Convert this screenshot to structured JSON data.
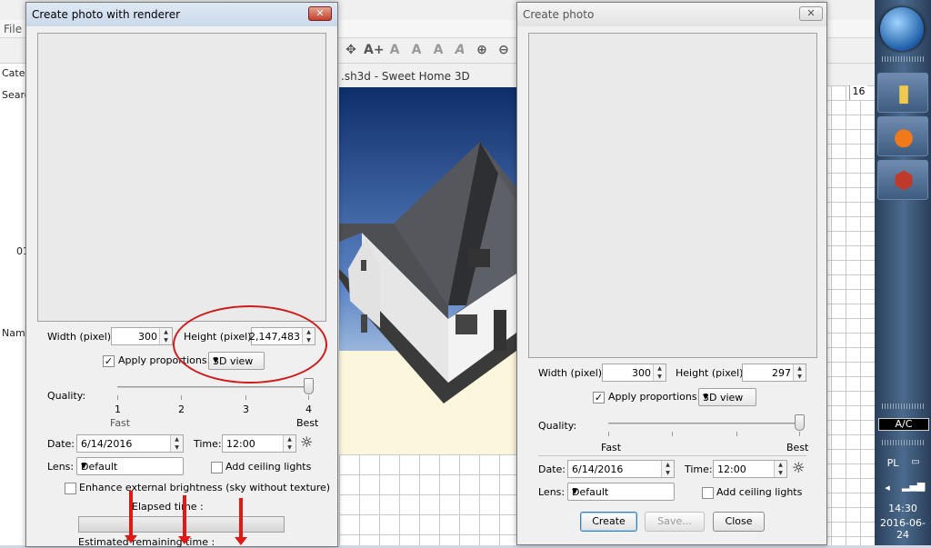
{
  "background": {
    "menu_file": "File",
    "left_labels": [
      "Cate",
      "Searc",
      "01",
      "Nam"
    ],
    "view_title": ".sh3d - Sweet Home 3D",
    "ruler_number": "16"
  },
  "dialog_renderer": {
    "title": "Create photo with renderer",
    "width_label": "Width (pixel):",
    "width_value": "300",
    "height_label": "Height (pixel):",
    "height_value": "2,147,483",
    "apply_proportions_label": "Apply proportions:",
    "apply_proportions_checked": true,
    "proportion_value": "3D view",
    "quality_label": "Quality:",
    "quality_ticks": [
      "1",
      "2",
      "3",
      "4"
    ],
    "quality_level": 4,
    "fast_label": "Fast",
    "best_label": "Best",
    "date_label": "Date:",
    "date_value": "6/14/2016",
    "time_label": "Time:",
    "time_value": "12:00",
    "lens_label": "Lens:",
    "lens_value": "Default",
    "ceiling_lights_label": "Add ceiling lights",
    "brightness_label": "Enhance external brightness (sky without texture)",
    "elapsed_label": "Elapsed time :",
    "remaining_label": "Estimated remaining time :"
  },
  "dialog_photo": {
    "title": "Create photo",
    "width_label": "Width (pixel):",
    "width_value": "300",
    "height_label": "Height (pixel):",
    "height_value": "297",
    "apply_proportions_label": "Apply proportions:",
    "apply_proportions_checked": true,
    "proportion_value": "3D view",
    "quality_label": "Quality:",
    "quality_level": 4,
    "fast_label": "Fast",
    "best_label": "Best",
    "date_label": "Date:",
    "date_value": "6/14/2016",
    "time_label": "Time:",
    "time_value": "12:00",
    "lens_label": "Lens:",
    "lens_value": "Default",
    "ceiling_lights_label": "Add ceiling lights",
    "create_button": "Create",
    "save_button": "Save...",
    "close_button": "Close"
  },
  "taskbar": {
    "battery": "A/C",
    "language": "PL",
    "time": "14:30",
    "date": "2016-06-24"
  },
  "colors": {
    "annotation": "#d01a1a",
    "taskbar": "#3a5578"
  }
}
